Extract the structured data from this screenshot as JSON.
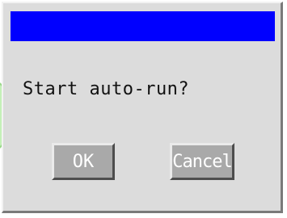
{
  "dialog": {
    "message": "Start auto-run?",
    "ok_label": "OK",
    "cancel_label": "Cancel"
  },
  "colors": {
    "titlebar": "#0000ff",
    "dialog_background": "#dcdcdc",
    "button_background": "#a9a9a9",
    "button_text": "#ffffff",
    "background_shape": "#c4f0b8"
  }
}
